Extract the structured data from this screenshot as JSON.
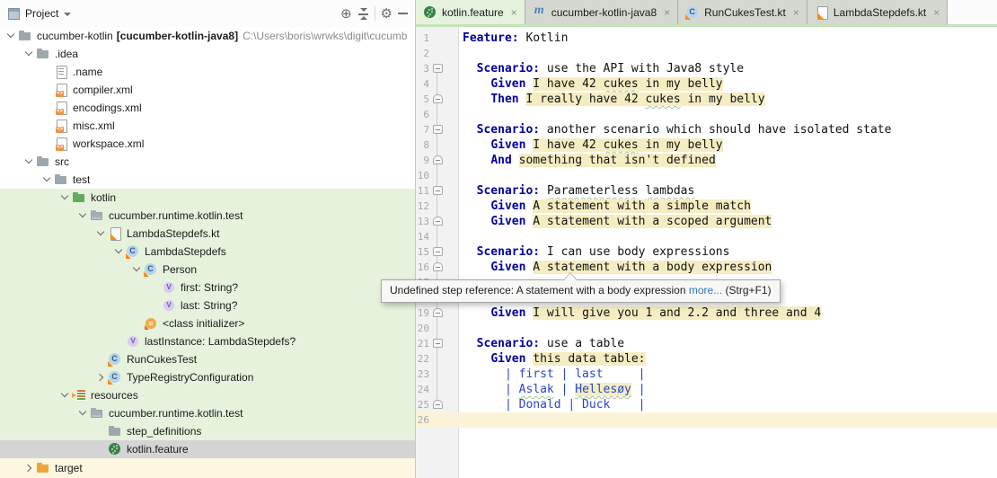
{
  "project_panel": {
    "title": "Project",
    "toolbar_icons": [
      "locate",
      "collapse-all",
      "settings",
      "hide-panel"
    ],
    "tree": [
      {
        "level": 0,
        "chevron": "down",
        "icon": "folder",
        "label": "cucumber-kotlin",
        "module": "[cucumber-kotlin-java8]",
        "path": "C:\\Users\\boris\\wrwks\\digit\\cucumb",
        "bg": ""
      },
      {
        "level": 1,
        "chevron": "down",
        "icon": "folder",
        "label": ".idea",
        "bg": ""
      },
      {
        "level": 2,
        "chevron": "",
        "icon": "file-text",
        "label": ".name",
        "bg": ""
      },
      {
        "level": 2,
        "chevron": "",
        "icon": "file-xml",
        "label": "compiler.xml",
        "bg": ""
      },
      {
        "level": 2,
        "chevron": "",
        "icon": "file-xml",
        "label": "encodings.xml",
        "bg": ""
      },
      {
        "level": 2,
        "chevron": "",
        "icon": "file-xml",
        "label": "misc.xml",
        "bg": ""
      },
      {
        "level": 2,
        "chevron": "",
        "icon": "file-xml",
        "label": "workspace.xml",
        "bg": ""
      },
      {
        "level": 1,
        "chevron": "down",
        "icon": "folder",
        "label": "src",
        "bg": ""
      },
      {
        "level": 2,
        "chevron": "down",
        "icon": "folder",
        "label": "test",
        "bg": ""
      },
      {
        "level": 3,
        "chevron": "down",
        "icon": "folder-green",
        "label": "kotlin",
        "bg": "g"
      },
      {
        "level": 4,
        "chevron": "down",
        "icon": "package",
        "label": "cucumber.runtime.kotlin.test",
        "bg": "g"
      },
      {
        "level": 5,
        "chevron": "down",
        "icon": "kotlin-file",
        "label": "LambdaStepdefs.kt",
        "bg": "g"
      },
      {
        "level": 6,
        "chevron": "down",
        "icon": "kotlin-class",
        "label": "LambdaStepdefs",
        "bg": "g"
      },
      {
        "level": 7,
        "chevron": "down",
        "icon": "kotlin-class",
        "label": "Person",
        "bg": "g"
      },
      {
        "level": 8,
        "chevron": "",
        "icon": "value",
        "label": "first: String?",
        "bg": "g"
      },
      {
        "level": 8,
        "chevron": "",
        "icon": "value",
        "label": "last: String?",
        "bg": "g"
      },
      {
        "level": 7,
        "chevron": "",
        "icon": "init",
        "label": "<class initializer>",
        "bg": "g"
      },
      {
        "level": 6,
        "chevron": "",
        "icon": "value",
        "label": "lastInstance: LambdaStepdefs?",
        "bg": "g"
      },
      {
        "level": 5,
        "chevron": "",
        "icon": "kotlin-class",
        "label": "RunCukesTest",
        "bg": "g"
      },
      {
        "level": 5,
        "chevron": "right",
        "icon": "kotlin-class",
        "label": "TypeRegistryConfiguration",
        "bg": "g"
      },
      {
        "level": 3,
        "chevron": "down",
        "icon": "resources",
        "label": "resources",
        "bg": "g"
      },
      {
        "level": 4,
        "chevron": "down",
        "icon": "package",
        "label": "cucumber.runtime.kotlin.test",
        "bg": "g"
      },
      {
        "level": 5,
        "chevron": "",
        "icon": "folder",
        "label": "step_definitions",
        "bg": "g"
      },
      {
        "level": 5,
        "chevron": "",
        "icon": "cucumber",
        "label": "kotlin.feature",
        "bg": "sel"
      },
      {
        "level": 1,
        "chevron": "right",
        "icon": "folder-orange",
        "label": "target",
        "bg": "y"
      }
    ]
  },
  "editor_tabs": [
    {
      "label": "kotlin.feature",
      "icon": "cucumber",
      "active": true
    },
    {
      "label": "cucumber-kotlin-java8",
      "icon": "maven",
      "active": false
    },
    {
      "label": "RunCukesTest.kt",
      "icon": "kotlin-class",
      "active": false
    },
    {
      "label": "LambdaStepdefs.kt",
      "icon": "kotlin-file",
      "active": false
    }
  ],
  "editor": {
    "lines": [
      {
        "n": 1,
        "fold": "",
        "segs": [
          [
            "k",
            "Feature:"
          ],
          [
            "p",
            " Kotlin"
          ]
        ]
      },
      {
        "n": 2,
        "fold": "",
        "segs": []
      },
      {
        "n": 3,
        "fold": "start",
        "segs": [
          [
            "p",
            "  "
          ],
          [
            "k",
            "Scenario:"
          ],
          [
            "p",
            " use the API with Java8 style"
          ]
        ]
      },
      {
        "n": 4,
        "fold": "",
        "segs": [
          [
            "p",
            "    "
          ],
          [
            "k",
            "Given"
          ],
          [
            "p",
            " "
          ],
          [
            "s",
            "I have 42 "
          ],
          [
            "sw",
            "cukes"
          ],
          [
            "s",
            " in my belly"
          ]
        ]
      },
      {
        "n": 5,
        "fold": "end",
        "segs": [
          [
            "p",
            "    "
          ],
          [
            "k",
            "Then"
          ],
          [
            "p",
            " "
          ],
          [
            "s",
            "I really have 42 "
          ],
          [
            "sw",
            "cukes"
          ],
          [
            "s",
            " in my belly"
          ]
        ]
      },
      {
        "n": 6,
        "fold": "",
        "segs": []
      },
      {
        "n": 7,
        "fold": "start",
        "segs": [
          [
            "p",
            "  "
          ],
          [
            "k",
            "Scenario:"
          ],
          [
            "p",
            " another scenario which should have isolated state"
          ]
        ]
      },
      {
        "n": 8,
        "fold": "",
        "segs": [
          [
            "p",
            "    "
          ],
          [
            "k",
            "Given"
          ],
          [
            "p",
            " "
          ],
          [
            "s",
            "I have 42 "
          ],
          [
            "sw",
            "cukes"
          ],
          [
            "s",
            " in my belly"
          ]
        ]
      },
      {
        "n": 9,
        "fold": "end",
        "segs": [
          [
            "p",
            "    "
          ],
          [
            "k",
            "And"
          ],
          [
            "p",
            " "
          ],
          [
            "s",
            "something that isn't defined"
          ]
        ]
      },
      {
        "n": 10,
        "fold": "",
        "segs": []
      },
      {
        "n": 11,
        "fold": "start",
        "segs": [
          [
            "p",
            "  "
          ],
          [
            "k",
            "Scenario:"
          ],
          [
            "p",
            " "
          ],
          [
            "pw",
            "Parameterless"
          ],
          [
            "p",
            " "
          ],
          [
            "pw",
            "lambdas"
          ]
        ]
      },
      {
        "n": 12,
        "fold": "",
        "segs": [
          [
            "p",
            "    "
          ],
          [
            "k",
            "Given"
          ],
          [
            "p",
            " "
          ],
          [
            "s",
            "A statement with a simple match"
          ]
        ]
      },
      {
        "n": 13,
        "fold": "end",
        "segs": [
          [
            "p",
            "    "
          ],
          [
            "k",
            "Given"
          ],
          [
            "p",
            " "
          ],
          [
            "s",
            "A statement with a scoped argument"
          ]
        ]
      },
      {
        "n": 14,
        "fold": "",
        "segs": []
      },
      {
        "n": 15,
        "fold": "start",
        "segs": [
          [
            "p",
            "  "
          ],
          [
            "k",
            "Scenario:"
          ],
          [
            "p",
            " I can use body expressions"
          ]
        ]
      },
      {
        "n": 16,
        "fold": "end",
        "segs": [
          [
            "p",
            "    "
          ],
          [
            "k",
            "Given"
          ],
          [
            "p",
            " "
          ],
          [
            "s",
            "A statement with a body expression"
          ]
        ]
      },
      {
        "n": 17,
        "fold": "",
        "segs": []
      },
      {
        "n": 18,
        "fold": "",
        "segs": []
      },
      {
        "n": 19,
        "fold": "end",
        "segs": [
          [
            "p",
            "    "
          ],
          [
            "k",
            "Given"
          ],
          [
            "p",
            " "
          ],
          [
            "s",
            "I will give you 1 and 2.2 and three and 4"
          ]
        ]
      },
      {
        "n": 20,
        "fold": "",
        "segs": []
      },
      {
        "n": 21,
        "fold": "start",
        "segs": [
          [
            "p",
            "  "
          ],
          [
            "k",
            "Scenario:"
          ],
          [
            "p",
            " use a table"
          ]
        ]
      },
      {
        "n": 22,
        "fold": "",
        "segs": [
          [
            "p",
            "    "
          ],
          [
            "k",
            "Given"
          ],
          [
            "p",
            " "
          ],
          [
            "s",
            "this data table:"
          ]
        ]
      },
      {
        "n": 23,
        "fold": "",
        "segs": [
          [
            "p",
            "      "
          ],
          [
            "t",
            "| first | last     |"
          ]
        ]
      },
      {
        "n": 24,
        "fold": "",
        "segs": [
          [
            "p",
            "      "
          ],
          [
            "t",
            "| "
          ],
          [
            "tw",
            "Aslak"
          ],
          [
            "t",
            " | "
          ],
          [
            "th",
            "Hellesøy"
          ],
          [
            "t",
            " |"
          ]
        ]
      },
      {
        "n": 25,
        "fold": "end",
        "segs": [
          [
            "p",
            "      "
          ],
          [
            "t",
            "| Donald | Duck    |"
          ]
        ]
      },
      {
        "n": 26,
        "fold": "",
        "cur": true,
        "segs": []
      }
    ]
  },
  "tooltip": {
    "text": "Undefined step reference: A statement with a body expression ",
    "link": "more...",
    "shortcut": " (Strg+F1)"
  }
}
